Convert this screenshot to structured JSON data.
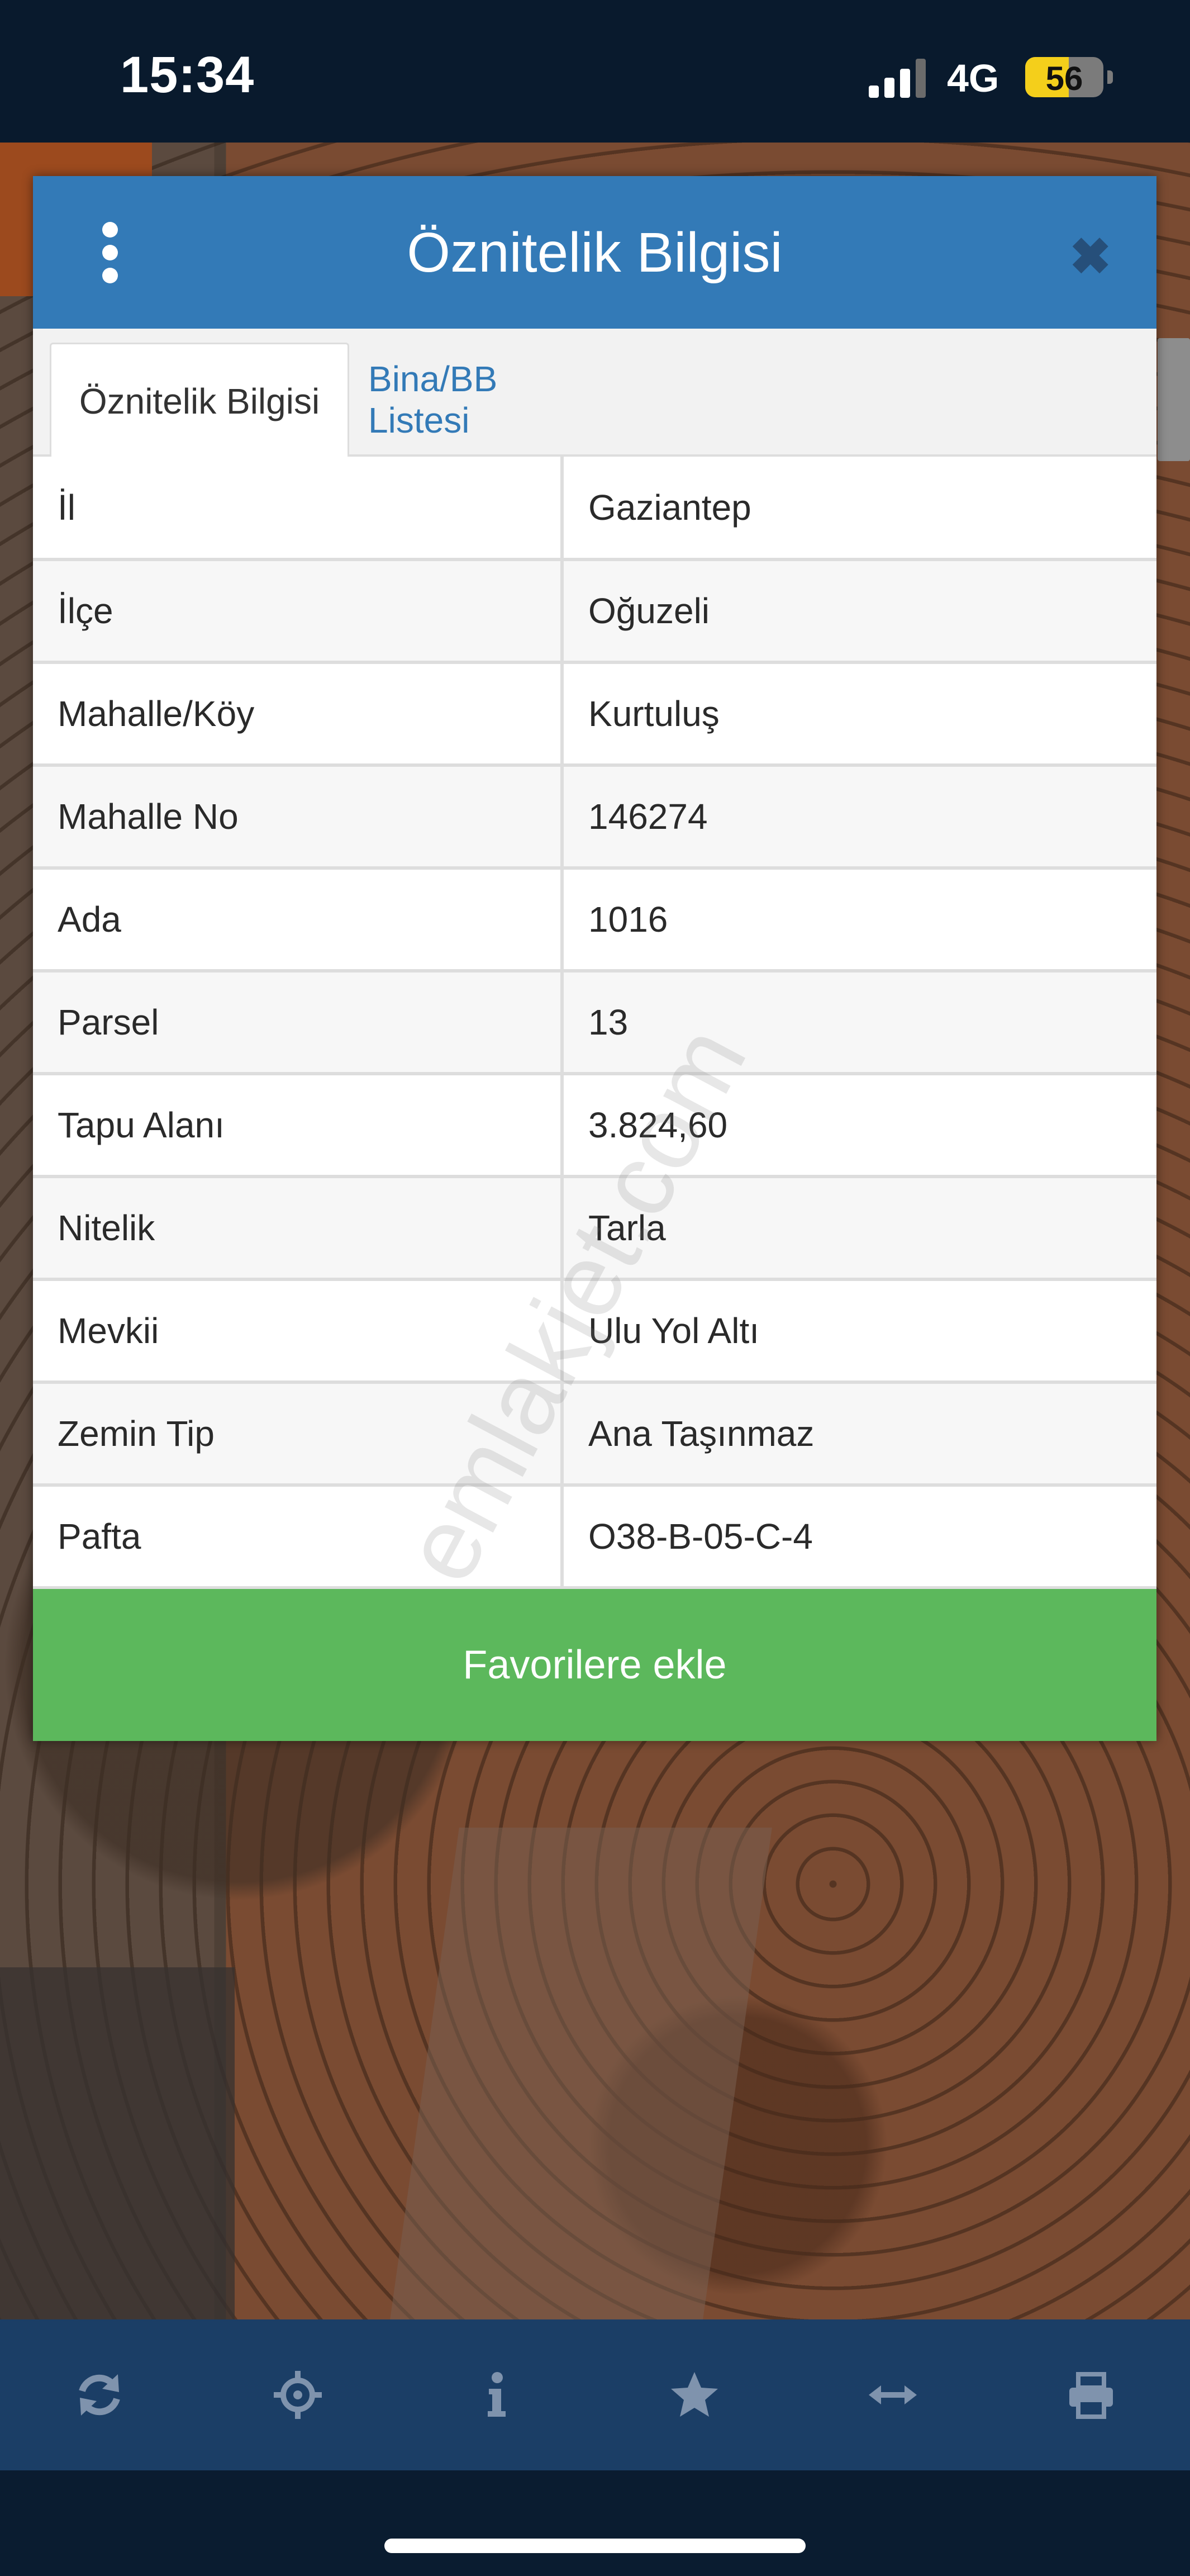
{
  "status_bar": {
    "time": "15:34",
    "network": "4G",
    "battery_level": "56",
    "battery_fraction": 0.56
  },
  "dialog": {
    "title": "Öznitelik Bilgisi",
    "menu_icon": "vertical-ellipsis-icon",
    "close_icon": "close-icon",
    "tabs": [
      {
        "label": "Öznitelik Bilgisi",
        "active": true
      },
      {
        "label": "Bina/BB Listesi",
        "active": false
      }
    ],
    "rows": [
      {
        "key": "İl",
        "value": "Gaziantep"
      },
      {
        "key": "İlçe",
        "value": "Oğuzeli"
      },
      {
        "key": "Mahalle/Köy",
        "value": "Kurtuluş"
      },
      {
        "key": "Mahalle No",
        "value": "146274"
      },
      {
        "key": "Ada",
        "value": "1016"
      },
      {
        "key": "Parsel",
        "value": "13"
      },
      {
        "key": "Tapu Alanı",
        "value": "3.824,60"
      },
      {
        "key": "Nitelik",
        "value": "Tarla"
      },
      {
        "key": "Mevkii",
        "value": "Ulu Yol Altı"
      },
      {
        "key": "Zemin Tip",
        "value": "Ana Taşınmaz"
      },
      {
        "key": "Pafta",
        "value": "O38-B-05-C-4"
      }
    ],
    "favorite_button": "Favorilere ekle",
    "watermark": "emlakjet.com"
  },
  "toolbar": {
    "icons": [
      "refresh-icon",
      "locate-icon",
      "info-icon",
      "star-icon",
      "measure-icon",
      "print-icon"
    ]
  },
  "colors": {
    "header": "#337ab7",
    "button": "#5cb85c",
    "toolbar": "#1b3e66",
    "status_bar": "#091a2d"
  }
}
